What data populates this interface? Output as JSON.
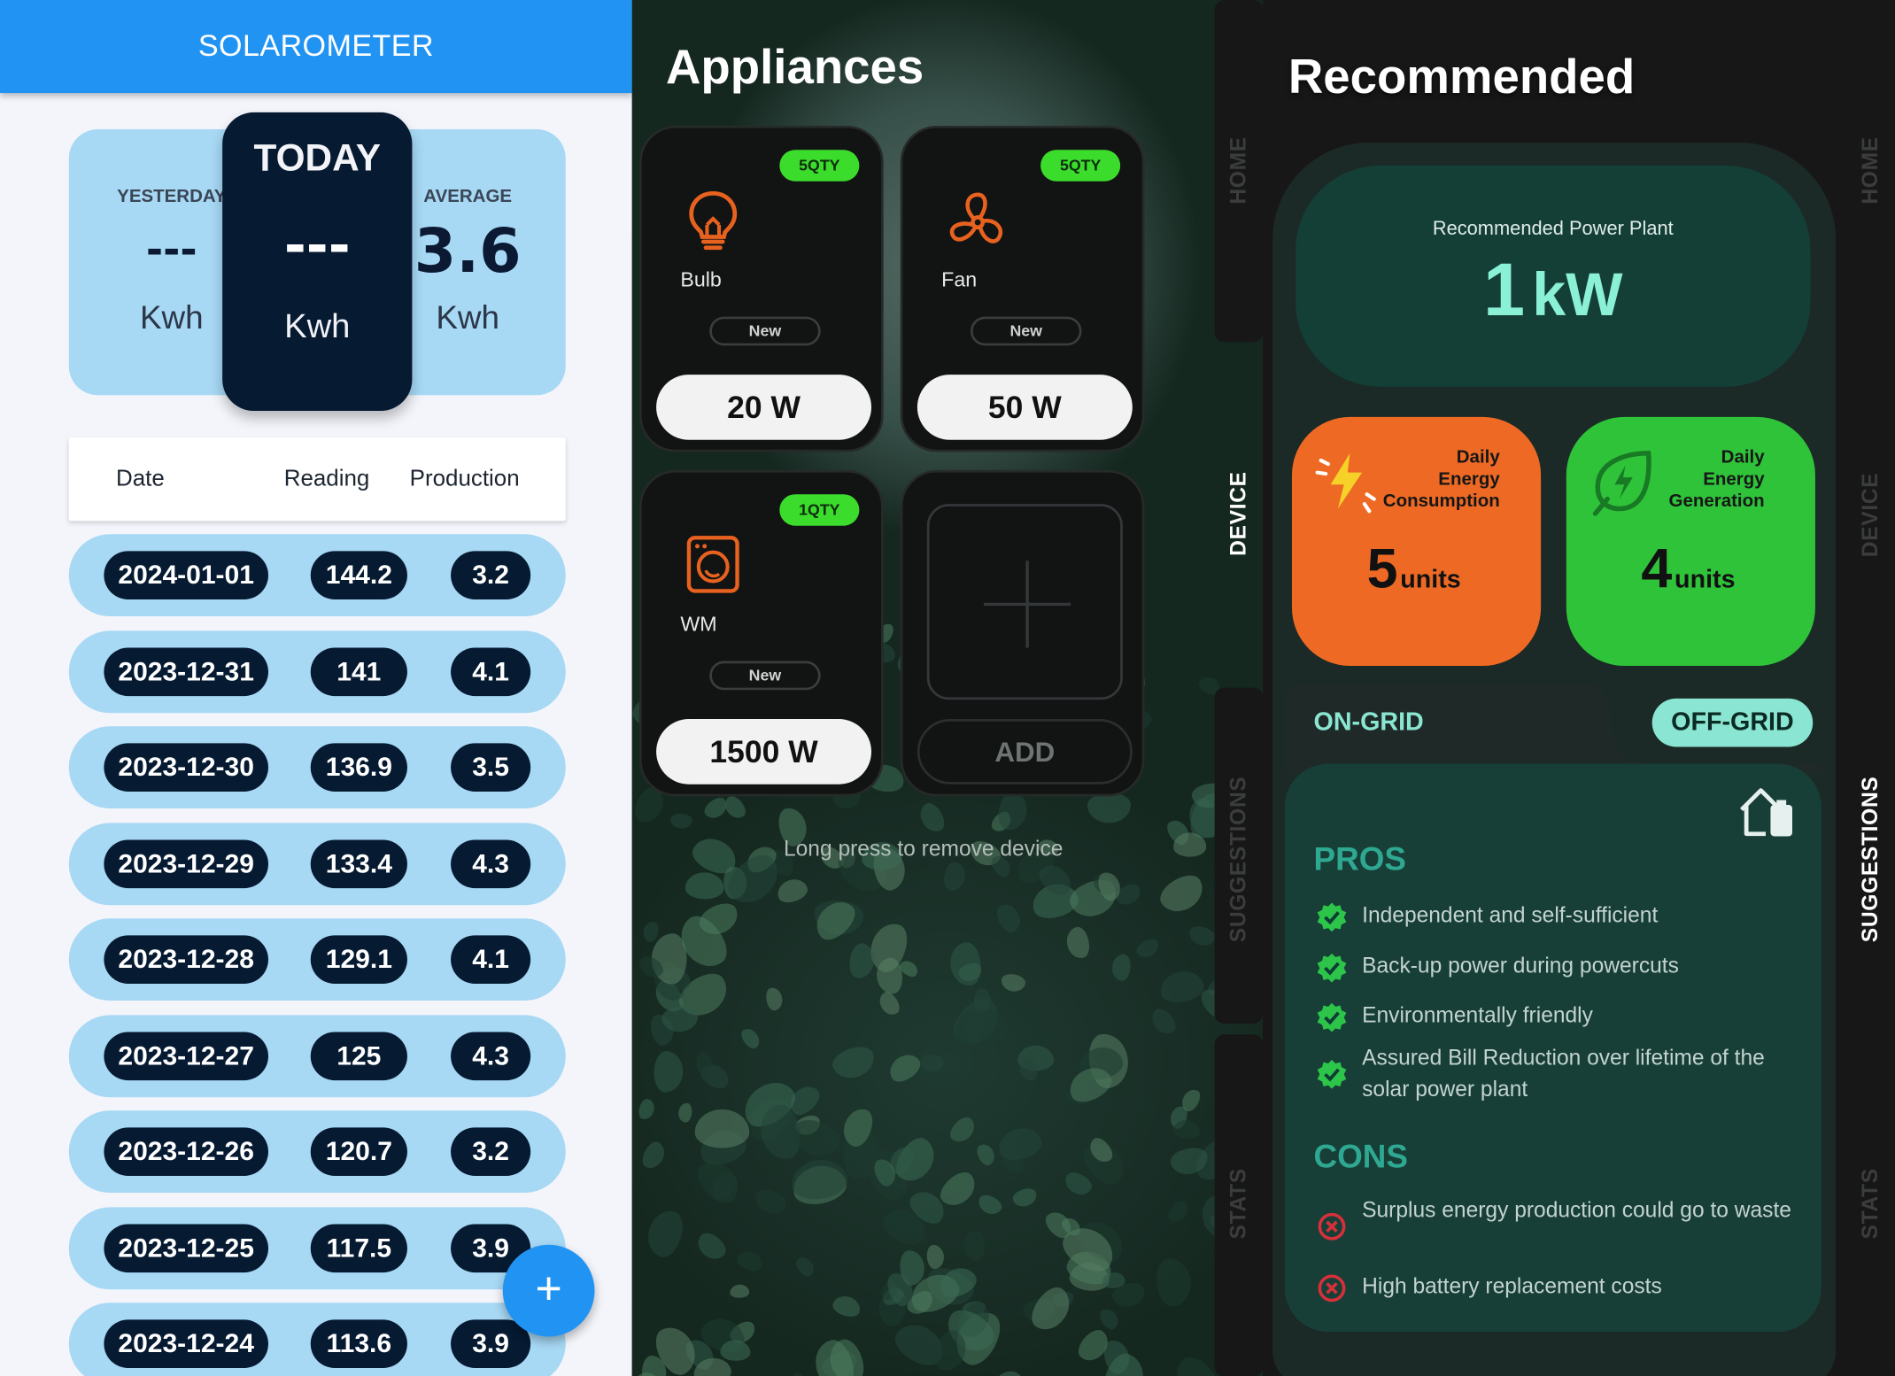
{
  "app": {
    "title": "SOLAROMETER"
  },
  "summary": {
    "yesterday": {
      "label": "YESTERDAY",
      "value": "---",
      "unit": "Kwh"
    },
    "today": {
      "label": "TODAY",
      "value": "---",
      "unit": "Kwh"
    },
    "average": {
      "label": "AVERAGE",
      "value": "3.6",
      "unit": "Kwh"
    }
  },
  "table": {
    "headers": [
      "Date",
      "Reading",
      "Production"
    ],
    "rows": [
      {
        "date": "2024-01-01",
        "reading": "144.2",
        "production": "3.2"
      },
      {
        "date": "2023-12-31",
        "reading": "141",
        "production": "4.1"
      },
      {
        "date": "2023-12-30",
        "reading": "136.9",
        "production": "3.5"
      },
      {
        "date": "2023-12-29",
        "reading": "133.4",
        "production": "4.3"
      },
      {
        "date": "2023-12-28",
        "reading": "129.1",
        "production": "4.1"
      },
      {
        "date": "2023-12-27",
        "reading": "125",
        "production": "4.3"
      },
      {
        "date": "2023-12-26",
        "reading": "120.7",
        "production": "3.2"
      },
      {
        "date": "2023-12-25",
        "reading": "117.5",
        "production": "3.9"
      },
      {
        "date": "2023-12-24",
        "reading": "113.6",
        "production": "3.9"
      }
    ]
  },
  "fab": {
    "icon": "plus-icon",
    "label": "+"
  },
  "appliances": {
    "title": "Appliances",
    "devices": [
      {
        "name": "Bulb",
        "qty": "5QTY",
        "status": "New",
        "watts": "20 W",
        "icon": "bulb-icon"
      },
      {
        "name": "Fan",
        "qty": "5QTY",
        "status": "New",
        "watts": "50 W",
        "icon": "fan-icon"
      },
      {
        "name": "WM",
        "qty": "1QTY",
        "status": "New",
        "watts": "1500 W",
        "icon": "washing-machine-icon"
      }
    ],
    "add_label": "ADD",
    "hint": "Long press to remove device"
  },
  "sidenav": {
    "items": [
      "HOME",
      "DEVICE",
      "SUGGESTIONS",
      "STATS"
    ]
  },
  "recommended": {
    "title": "Recommended",
    "plant_label": "Recommended Power Plant",
    "plant_value": "1",
    "plant_unit": "kW",
    "consumption": {
      "title_lines": [
        "Daily",
        "Energy",
        "Consumption"
      ],
      "value": "5",
      "unit": "units",
      "color": "#ee6a24"
    },
    "generation": {
      "title_lines": [
        "Daily",
        "Energy",
        "Generation"
      ],
      "value": "4",
      "unit": "units",
      "color": "#2fc33a"
    },
    "tabs": {
      "on_grid": "ON-GRID",
      "off_grid": "OFF-GRID"
    },
    "pros_title": "PROS",
    "pros": [
      "Independent and self-sufficient",
      "Back-up power during powercuts",
      "Environmentally friendly",
      "Assured Bill Reduction over lifetime of the solar power plant"
    ],
    "cons_title": "CONS",
    "cons": [
      "Surplus energy production could go to waste",
      "High battery replacement costs"
    ]
  },
  "colors": {
    "primary_blue": "#2194f3",
    "navy": "#061a32",
    "light_blue": "#a7d8f4",
    "accent_green": "#3bdc2c",
    "teal": "#2fa892",
    "orange": "#ee6a24"
  }
}
